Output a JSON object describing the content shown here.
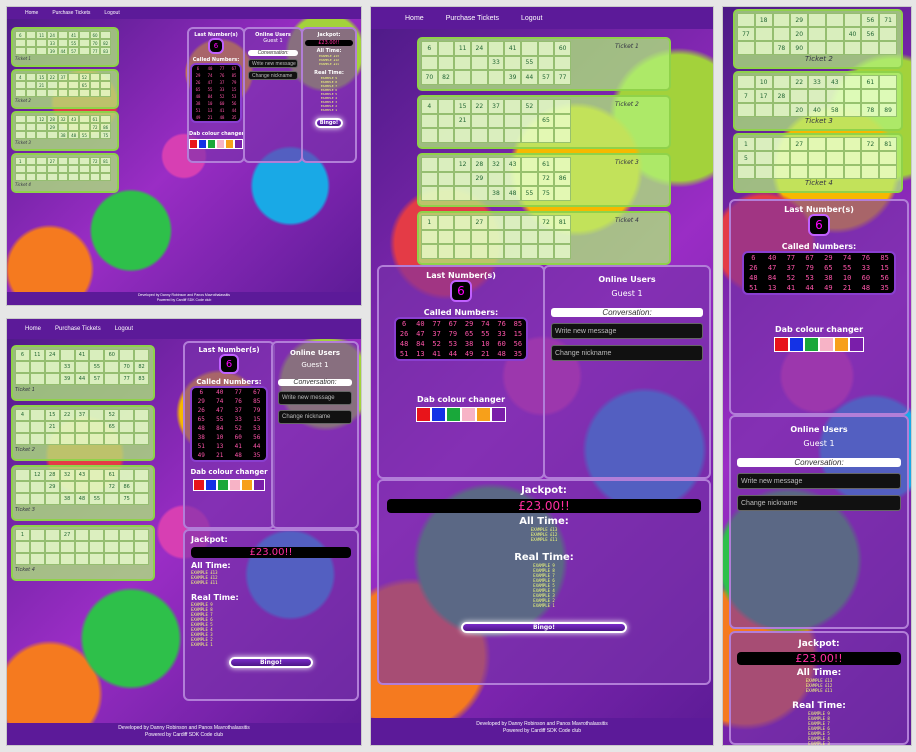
{
  "nav": {
    "home": "Home",
    "purchase": "Purchase Tickets",
    "logout": "Logout"
  },
  "footer": {
    "line1": "Developed by Danny Robinson and Panos Mavrothalassitis",
    "line2": "Powered by Cardiff SDK Code club"
  },
  "tickets": [
    {
      "label": "Ticket 1",
      "cells": [
        "6",
        "",
        "11",
        "24",
        "",
        "41",
        "",
        "60",
        "",
        "",
        "",
        "",
        "33",
        "",
        "55",
        "",
        "70",
        "82",
        "",
        "",
        "",
        "39",
        "44",
        "57",
        "",
        "77",
        "83"
      ]
    },
    {
      "label": "Ticket 2",
      "cells": [
        "4",
        "",
        "15",
        "22",
        "37",
        "",
        "52",
        "",
        "",
        "",
        "",
        "21",
        "",
        "",
        "",
        "65",
        "",
        "",
        "",
        "",
        "",
        "",
        "",
        "",
        "",
        "",
        ""
      ]
    },
    {
      "label": "Ticket 3",
      "cells": [
        "",
        "",
        "12",
        "28",
        "32",
        "43",
        "",
        "61",
        "",
        "",
        "",
        "",
        "29",
        "",
        "",
        "",
        "72",
        "86",
        "",
        "",
        "",
        "",
        "38",
        "48",
        "55",
        "",
        "75"
      ]
    },
    {
      "label": "Ticket 4",
      "cells": [
        "1",
        "",
        "",
        "27",
        "",
        "",
        "",
        "72",
        "81",
        "",
        "",
        "",
        "",
        "",
        "",
        "",
        "",
        "",
        "",
        "",
        "",
        "",
        "",
        "",
        "",
        "",
        ""
      ]
    }
  ],
  "ticketsB": [
    {
      "label": "Ticket 1",
      "cells": [
        "6",
        "11",
        "24",
        "",
        "41",
        "",
        "60",
        "",
        "",
        "",
        "",
        "",
        "33",
        "",
        "55",
        "",
        "70",
        "82",
        "",
        "",
        "",
        "39",
        "44",
        "57",
        "",
        "77",
        "83"
      ]
    },
    {
      "label": "Ticket 2",
      "cells": [
        "4",
        "",
        "15",
        "22",
        "37",
        "",
        "52",
        "",
        "",
        "",
        "",
        "21",
        "",
        "",
        "",
        "65",
        "",
        "",
        "",
        "",
        "",
        "",
        "",
        "",
        "",
        "",
        ""
      ]
    },
    {
      "label": "Ticket 3",
      "cells": [
        "",
        "12",
        "28",
        "32",
        "43",
        "",
        "61",
        "",
        "",
        "",
        "",
        "29",
        "",
        "",
        "",
        "72",
        "86",
        "",
        "",
        "",
        "",
        "38",
        "48",
        "55",
        "",
        "75",
        ""
      ]
    },
    {
      "label": "Ticket 4",
      "cells": [
        "1",
        "",
        "",
        "27",
        "",
        "",
        "",
        "",
        "",
        "",
        "",
        "",
        "",
        "",
        "",
        "",
        "",
        "",
        "",
        "",
        "",
        "",
        "",
        "",
        "",
        "",
        ""
      ]
    }
  ],
  "ticketsC": [
    {
      "label": "Ticket 1",
      "cells": [
        "6",
        "",
        "11",
        "24",
        "",
        "41",
        "",
        "",
        "60",
        "",
        "",
        "",
        "",
        "33",
        "",
        "55",
        "",
        "",
        "70",
        "82",
        "",
        "",
        "",
        "39",
        "44",
        "57",
        "77"
      ]
    },
    {
      "label": "Ticket 2",
      "cells": [
        "4",
        "",
        "15",
        "22",
        "37",
        "",
        "52",
        "",
        "",
        "",
        "",
        "21",
        "",
        "",
        "",
        "",
        "65",
        "",
        "",
        "",
        "",
        "",
        "",
        "",
        "",
        "",
        ""
      ]
    },
    {
      "label": "Ticket 3",
      "cells": [
        "",
        "",
        "12",
        "28",
        "32",
        "43",
        "",
        "61",
        "",
        "",
        "",
        "",
        "29",
        "",
        "",
        "",
        "72",
        "86",
        "",
        "",
        "",
        "",
        "38",
        "48",
        "55",
        "75",
        ""
      ]
    },
    {
      "label": "Ticket 4",
      "cells": [
        "1",
        "",
        "",
        "27",
        "",
        "",
        "",
        "72",
        "81",
        "",
        "",
        "",
        "",
        "",
        "",
        "",
        "",
        "",
        "",
        "",
        "",
        "",
        "",
        "",
        "",
        "",
        ""
      ]
    }
  ],
  "ticketsR": [
    {
      "label": "Ticket 2",
      "cells": [
        "",
        "18",
        "",
        "29",
        "",
        "",
        "",
        "56",
        "71",
        "77",
        "",
        "",
        "20",
        "",
        "",
        "40",
        "56",
        "",
        "",
        "",
        "78",
        "90",
        "",
        "",
        "",
        "",
        ""
      ]
    },
    {
      "label": "Ticket 3",
      "cells": [
        "",
        "10",
        "",
        "22",
        "33",
        "43",
        "",
        "61",
        "",
        "7",
        "17",
        "28",
        "",
        "",
        "",
        "",
        "",
        "",
        "",
        "",
        "",
        "20",
        "40",
        "58",
        "",
        "78",
        "89"
      ]
    },
    {
      "label": "Ticket 4",
      "cells": [
        "1",
        "",
        "",
        "27",
        "",
        "",
        "",
        "72",
        "81",
        "5",
        "",
        "",
        "",
        "",
        "",
        "",
        "",
        "",
        "",
        "",
        "",
        "",
        "",
        "",
        "",
        "",
        ""
      ]
    }
  ],
  "game": {
    "last_numbers_label": "Last Number(s)",
    "last_number": "6",
    "called_label": "Called Numbers:",
    "called": [
      "6",
      "40",
      "77",
      "67",
      "29",
      "74",
      "76",
      "85",
      "26",
      "47",
      "37",
      "79",
      "65",
      "55",
      "33",
      "15",
      "48",
      "84",
      "52",
      "53",
      "38",
      "10",
      "60",
      "56",
      "51",
      "13",
      "41",
      "44",
      "49",
      "21",
      "48",
      "35"
    ],
    "dab_label": "Dab colour changer",
    "dab_colors": [
      "#e8141a",
      "#1432e6",
      "#19a83a",
      "#f7b3c6",
      "#f7a01a",
      "#7a1eaa"
    ]
  },
  "users": {
    "title": "Online Users",
    "guest": "Guest 1",
    "conversation": "Conversation:",
    "message_placeholder": "Write new message",
    "nickname_placeholder": "Change nickname"
  },
  "jackpot": {
    "title": "Jackpot:",
    "value": "£23.00!!",
    "alltime": "All Time:",
    "alltime_lines": [
      "EXAMPLE £13",
      "EXAMPLE £12",
      "EXAMPLE £11"
    ],
    "realtime": "Real Time:",
    "realtime_lines": [
      "EXAMPLE 9",
      "EXAMPLE 8",
      "EXAMPLE 7",
      "EXAMPLE 6",
      "EXAMPLE 5",
      "EXAMPLE 4",
      "EXAMPLE 3",
      "EXAMPLE 2",
      "EXAMPLE 1"
    ]
  },
  "bingo_button": "Bingo!"
}
